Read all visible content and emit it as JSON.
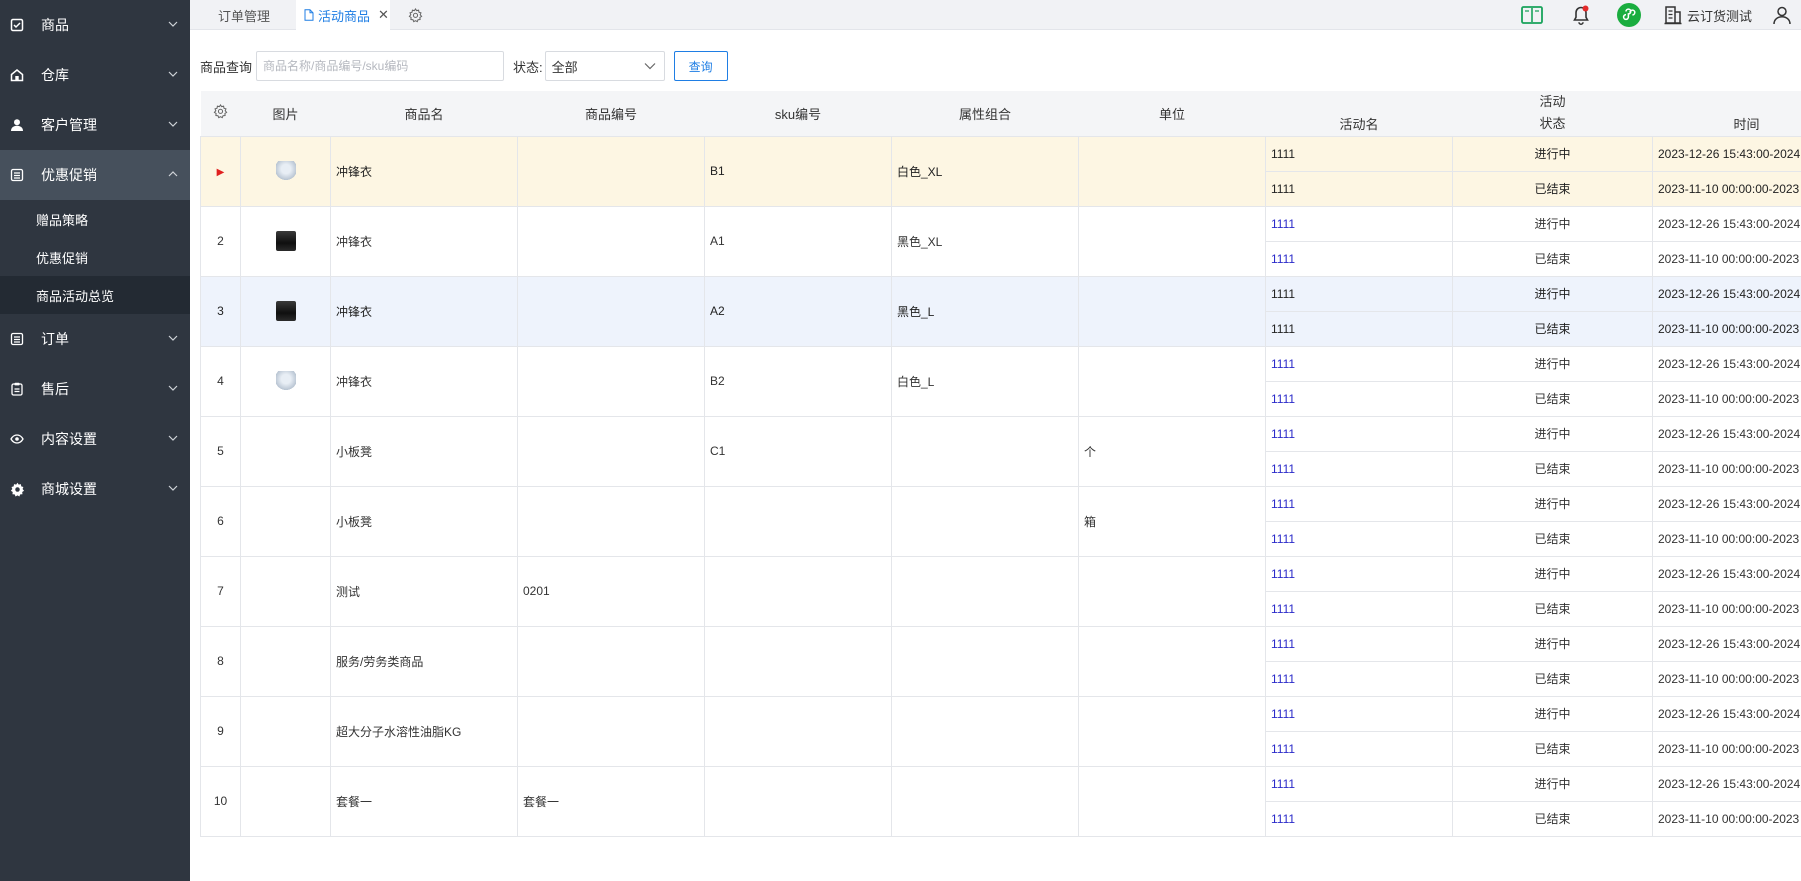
{
  "sidebar": {
    "items": [
      {
        "label": "商品",
        "icon": "checkbox-icon"
      },
      {
        "label": "仓库",
        "icon": "home-icon"
      },
      {
        "label": "客户管理",
        "icon": "user-icon"
      },
      {
        "label": "优惠促销",
        "icon": "list-icon",
        "active": true
      },
      {
        "label": "订单",
        "icon": "list-icon"
      },
      {
        "label": "售后",
        "icon": "clipboard-icon"
      },
      {
        "label": "内容设置",
        "icon": "eye-icon"
      },
      {
        "label": "商城设置",
        "icon": "gear-icon"
      }
    ],
    "sub_items": [
      {
        "label": "赠品策略"
      },
      {
        "label": "优惠促销"
      },
      {
        "label": "商品活动总览",
        "active": true
      }
    ]
  },
  "tabs": [
    {
      "label": "订单管理"
    },
    {
      "label": "活动商品",
      "active": true
    }
  ],
  "header": {
    "user_name": "云订货测试"
  },
  "search": {
    "label": "商品查询",
    "placeholder": "商品名称/商品编号/sku编码",
    "status_label": "状态:",
    "status_value": "全部",
    "button": "查询"
  },
  "table": {
    "headers": {
      "image": "图片",
      "name": "商品名",
      "code": "商品编号",
      "sku": "sku编号",
      "attr": "属性组合",
      "unit": "单位",
      "activity_group": "活动",
      "activity_name": "活动名",
      "activity_status": "状态",
      "activity_time": "时间"
    },
    "rows": [
      {
        "index": "▶",
        "thumb": "white",
        "name": "冲锋衣",
        "code": "",
        "sku": "B1",
        "attr": "白色_XL",
        "unit": "",
        "activities": [
          {
            "name": "1111",
            "status": "进行中",
            "time": "2023-12-26 15:43:00-2024"
          },
          {
            "name": "1111",
            "status": "已结束",
            "time": "2023-11-10 00:00:00-2023"
          }
        ]
      },
      {
        "index": "2",
        "thumb": "black",
        "name": "冲锋衣",
        "code": "",
        "sku": "A1",
        "attr": "黑色_XL",
        "unit": "",
        "activities": [
          {
            "name": "1111",
            "status": "进行中",
            "time": "2023-12-26 15:43:00-2024"
          },
          {
            "name": "1111",
            "status": "已结束",
            "time": "2023-11-10 00:00:00-2023"
          }
        ]
      },
      {
        "index": "3",
        "thumb": "black",
        "name": "冲锋衣",
        "code": "",
        "sku": "A2",
        "attr": "黑色_L",
        "unit": "",
        "activities": [
          {
            "name": "1111",
            "status": "进行中",
            "time": "2023-12-26 15:43:00-2024"
          },
          {
            "name": "1111",
            "status": "已结束",
            "time": "2023-11-10 00:00:00-2023"
          }
        ]
      },
      {
        "index": "4",
        "thumb": "white",
        "name": "冲锋衣",
        "code": "",
        "sku": "B2",
        "attr": "白色_L",
        "unit": "",
        "activities": [
          {
            "name": "1111",
            "status": "进行中",
            "time": "2023-12-26 15:43:00-2024"
          },
          {
            "name": "1111",
            "status": "已结束",
            "time": "2023-11-10 00:00:00-2023"
          }
        ]
      },
      {
        "index": "5",
        "thumb": "",
        "name": "小板凳",
        "code": "",
        "sku": "C1",
        "attr": "",
        "unit": "个",
        "activities": [
          {
            "name": "1111",
            "status": "进行中",
            "time": "2023-12-26 15:43:00-2024"
          },
          {
            "name": "1111",
            "status": "已结束",
            "time": "2023-11-10 00:00:00-2023"
          }
        ]
      },
      {
        "index": "6",
        "thumb": "",
        "name": "小板凳",
        "code": "",
        "sku": "",
        "attr": "",
        "unit": "箱",
        "activities": [
          {
            "name": "1111",
            "status": "进行中",
            "time": "2023-12-26 15:43:00-2024"
          },
          {
            "name": "1111",
            "status": "已结束",
            "time": "2023-11-10 00:00:00-2023"
          }
        ]
      },
      {
        "index": "7",
        "thumb": "",
        "name": "测试",
        "code": "0201",
        "sku": "",
        "attr": "",
        "unit": "",
        "activities": [
          {
            "name": "1111",
            "status": "进行中",
            "time": "2023-12-26 15:43:00-2024"
          },
          {
            "name": "1111",
            "status": "已结束",
            "time": "2023-11-10 00:00:00-2023"
          }
        ]
      },
      {
        "index": "8",
        "thumb": "",
        "name": "服务/劳务类商品",
        "code": "",
        "sku": "",
        "attr": "",
        "unit": "",
        "activities": [
          {
            "name": "1111",
            "status": "进行中",
            "time": "2023-12-26 15:43:00-2024"
          },
          {
            "name": "1111",
            "status": "已结束",
            "time": "2023-11-10 00:00:00-2023"
          }
        ]
      },
      {
        "index": "9",
        "thumb": "",
        "name": "超大分子水溶性油脂KG",
        "code": "",
        "sku": "",
        "attr": "",
        "unit": "",
        "activities": [
          {
            "name": "1111",
            "status": "进行中",
            "time": "2023-12-26 15:43:00-2024"
          },
          {
            "name": "1111",
            "status": "已结束",
            "time": "2023-11-10 00:00:00-2023"
          }
        ]
      },
      {
        "index": "10",
        "thumb": "",
        "name": "套餐一",
        "code": "套餐一",
        "sku": "",
        "attr": "",
        "unit": "",
        "activities": [
          {
            "name": "1111",
            "status": "进行中",
            "time": "2023-12-26 15:43:00-2024"
          },
          {
            "name": "1111",
            "status": "已结束",
            "time": "2023-11-10 00:00:00-2023"
          }
        ]
      }
    ]
  },
  "colors": {
    "sidebar_bg": "#2f3640",
    "accent": "#1f7ee4",
    "highlight_row": "#fdf6e3",
    "selected_row": "#eef3fc",
    "activity_link": "#2a2ac9"
  }
}
